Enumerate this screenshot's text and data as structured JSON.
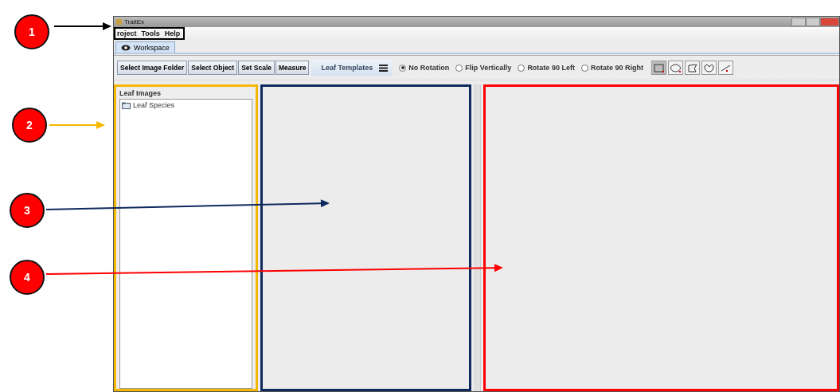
{
  "window": {
    "title": "TraitEx"
  },
  "menu": [
    "roject",
    "Tools",
    "Help"
  ],
  "tabs": [
    {
      "label": "Workspace",
      "selected": true
    }
  ],
  "toolbar": {
    "buttons": [
      "Select Image Folder",
      "Select Object",
      "Set Scale",
      "Measure"
    ],
    "templates": "Leaf Templates",
    "rotation": [
      {
        "label": "No Rotation",
        "selected": true
      },
      {
        "label": "Flip Vertically",
        "selected": false
      },
      {
        "label": "Rotate 90 Left",
        "selected": false
      },
      {
        "label": "Rotate 90 Right",
        "selected": false
      }
    ],
    "tools": [
      {
        "kind": "rectangle",
        "selected": true
      },
      {
        "kind": "ellipse",
        "selected": false
      },
      {
        "kind": "polygon",
        "selected": false
      },
      {
        "kind": "freehand",
        "selected": false
      },
      {
        "kind": "line",
        "selected": false
      }
    ]
  },
  "leaf_panel": {
    "title": "Leaf Images",
    "tree": [
      {
        "label": "Leaf Species"
      }
    ]
  },
  "annotations": [
    {
      "label": "1",
      "color": "#000000"
    },
    {
      "label": "2",
      "color": "#f5b800"
    },
    {
      "label": "3",
      "color": "#0f2a5e"
    },
    {
      "label": "4",
      "color": "#ff0000"
    }
  ]
}
